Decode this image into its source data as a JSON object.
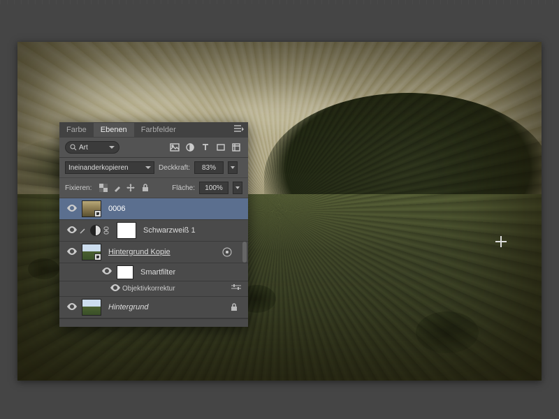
{
  "panel": {
    "tabs": [
      "Farbe",
      "Ebenen",
      "Farbfelder"
    ],
    "activeTab": 1,
    "filterKind": "Art",
    "blendMode": "Ineinanderkopieren",
    "opacityLabel": "Deckkraft:",
    "opacityValue": "83%",
    "lockLabel": "Fixieren:",
    "fillLabel": "Fläche:",
    "fillValue": "100%"
  },
  "layers": {
    "l0": {
      "name": "0006"
    },
    "l1": {
      "name": "Schwarzweiß 1"
    },
    "l2": {
      "name": "Hintergrund Kopie"
    },
    "l2a": {
      "name": "Smartfilter"
    },
    "l2b": {
      "name": "Objektivkorrektur"
    },
    "l3": {
      "name": "Hintergrund"
    }
  }
}
